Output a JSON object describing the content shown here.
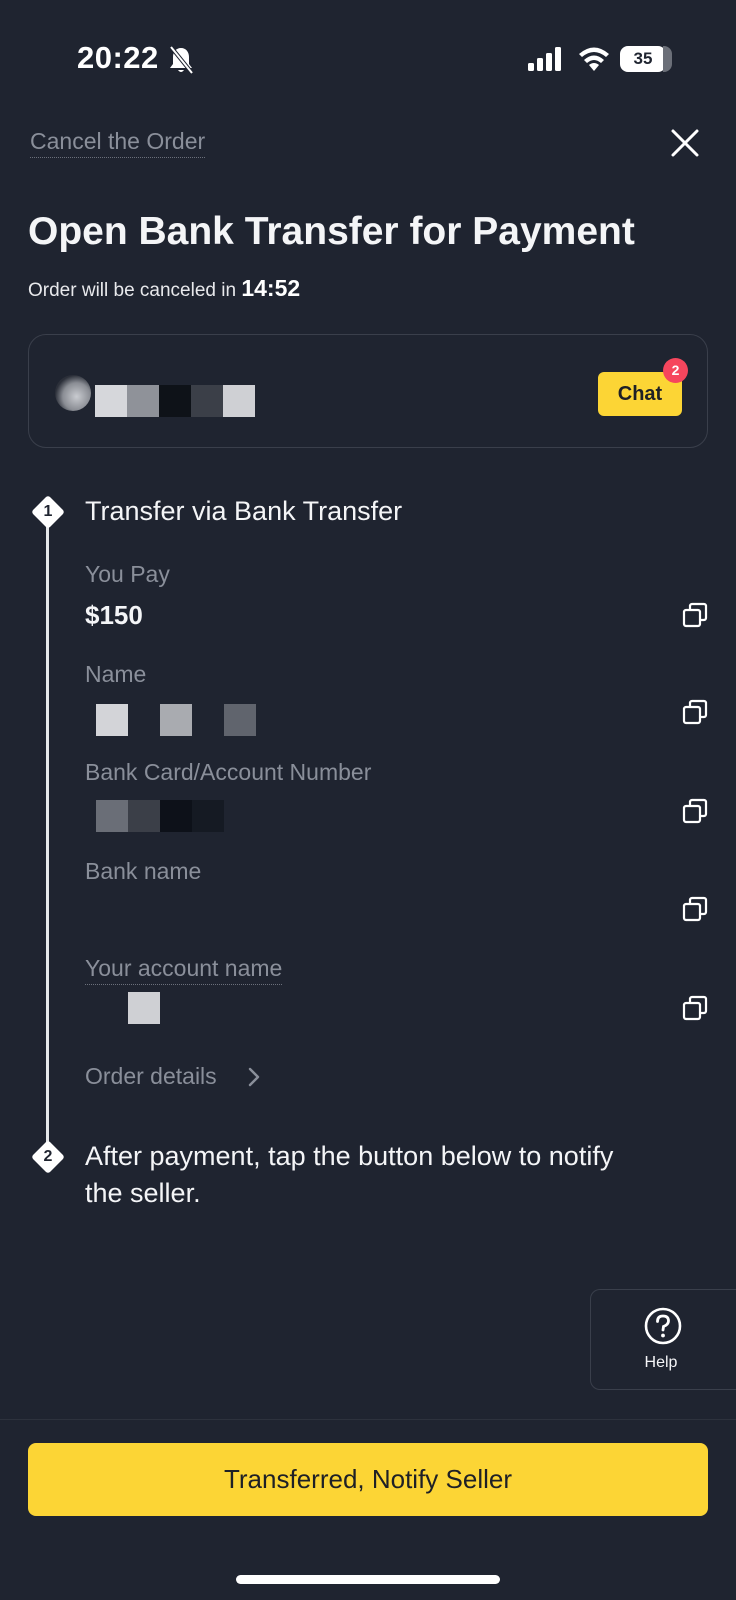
{
  "status_bar": {
    "time": "20:22",
    "battery_level": "35"
  },
  "header": {
    "cancel_label": "Cancel the Order",
    "title": "Open Bank Transfer for Payment",
    "countdown_prefix": "Order will be canceled in ",
    "countdown_time": "14:52"
  },
  "seller": {
    "chat_label": "Chat",
    "chat_badge": "2"
  },
  "step1": {
    "number": "1",
    "title": "Transfer via Bank Transfer",
    "fields": [
      {
        "label": "You Pay",
        "value": "$150"
      },
      {
        "label": "Name",
        "value": ""
      },
      {
        "label": "Bank Card/Account Number",
        "value": ""
      },
      {
        "label": "Bank name",
        "value": ""
      },
      {
        "label": "Your account name",
        "value": ""
      }
    ],
    "order_details_label": "Order details"
  },
  "step2": {
    "number": "2",
    "title_line1": "After payment, tap the button below to notify",
    "title_line2": "the seller."
  },
  "help": {
    "label": "Help"
  },
  "footer": {
    "primary_label": "Transferred, Notify Seller"
  },
  "colors": {
    "background": "#1f2430",
    "accent_yellow": "#fcd535",
    "badge_red": "#f6465d",
    "muted_text": "#8a8f9a"
  },
  "icons": [
    "bell-off-icon",
    "signal-icon",
    "wifi-icon",
    "battery-icon",
    "close-icon",
    "copy-icon",
    "chevron-right-icon",
    "help-icon"
  ]
}
